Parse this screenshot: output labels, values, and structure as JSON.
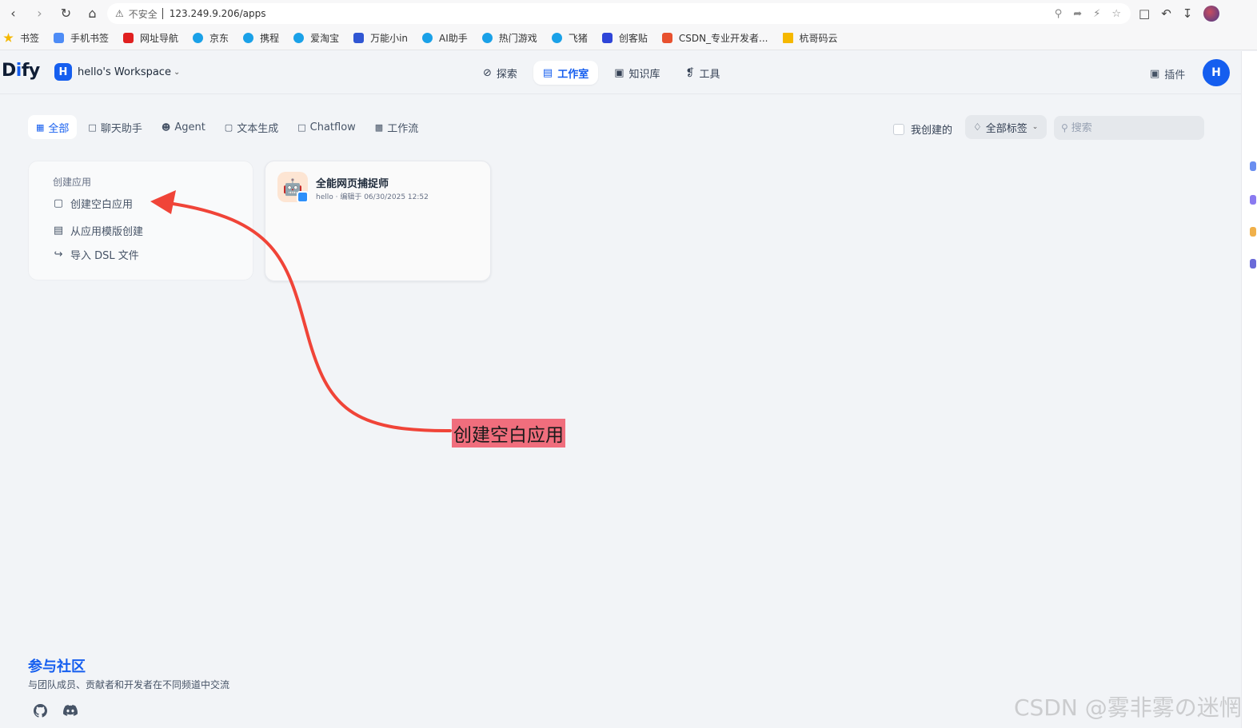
{
  "browser": {
    "insecure_label": "不安全",
    "url": "123.249.9.206/apps"
  },
  "bookmarks": [
    {
      "label": "书签",
      "color": "#f5b800"
    },
    {
      "label": "手机书签",
      "color": "#4e8cf6"
    },
    {
      "label": "网址导航",
      "color": "#e02020"
    },
    {
      "label": "京东",
      "color": "#1aa1e8"
    },
    {
      "label": "携程",
      "color": "#1aa1e8"
    },
    {
      "label": "爱淘宝",
      "color": "#1aa1e8"
    },
    {
      "label": "万能小in",
      "color": "#3056d3"
    },
    {
      "label": "AI助手",
      "color": "#1aa1e8"
    },
    {
      "label": "热门游戏",
      "color": "#1aa1e8"
    },
    {
      "label": "飞猪",
      "color": "#1aa1e8"
    },
    {
      "label": "创客贴",
      "color": "#2f45d8"
    },
    {
      "label": "CSDN_专业开发者...",
      "color": "#e8512f"
    },
    {
      "label": "杭哥码云",
      "color": "#f5b800"
    }
  ],
  "header": {
    "logo_main": "D",
    "logo_i": "i",
    "logo_rest": "fy",
    "workspace_initial": "H",
    "workspace_name": "hello's Workspace",
    "nav": [
      {
        "label": "探索",
        "active": false
      },
      {
        "label": "工作室",
        "active": true
      },
      {
        "label": "知识库",
        "active": false
      },
      {
        "label": "工具",
        "active": false
      }
    ],
    "plugins_label": "插件",
    "avatar_initial": "H",
    "accent": "#155eef"
  },
  "filters": {
    "tabs": [
      "全部",
      "聊天助手",
      "Agent",
      "文本生成",
      "Chatflow",
      "工作流"
    ],
    "mine_label": "我创建的",
    "tags_label": "全部标签",
    "search_placeholder": "搜索"
  },
  "create": {
    "title": "创建应用",
    "items": [
      "创建空白应用",
      "从应用模版创建",
      "导入 DSL 文件"
    ]
  },
  "apps": [
    {
      "name": "全能网页捕捉师",
      "meta": "hello · 编辑于 06/30/2025 12:52"
    }
  ],
  "annotation": {
    "label": "创建空白应用",
    "color": "#f04438"
  },
  "community": {
    "title": "参与社区",
    "desc": "与团队成员、贡献者和开发者在不同频道中交流"
  },
  "watermark": "CSDN @雾非雾の迷惘"
}
